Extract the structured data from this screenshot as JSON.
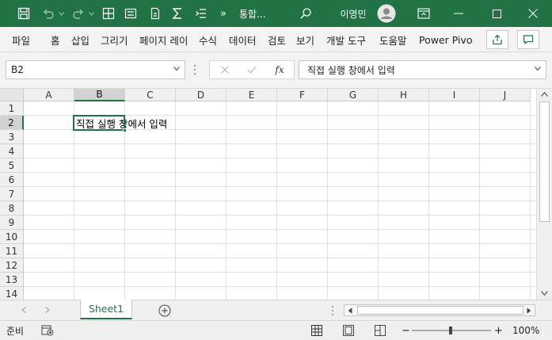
{
  "titlebar": {
    "doc_title": "통합...",
    "user_name": "이영민",
    "quick_access": [
      "save-icon",
      "undo-icon",
      "redo-icon",
      "table-icon",
      "form-icon",
      "document-icon",
      "sum-icon",
      "indent-icon"
    ],
    "more": "»"
  },
  "ribbon": {
    "tabs": [
      "파일",
      "홈",
      "삽입",
      "그리기",
      "페이지 레이",
      "수식",
      "데이터",
      "검토",
      "보기",
      "개발 도구",
      "도움말",
      "Power Pivo"
    ]
  },
  "formula_bar": {
    "name_box": "B2",
    "fx": "fx",
    "formula": "직접 실행 창에서 입력"
  },
  "grid": {
    "columns": [
      "A",
      "B",
      "C",
      "D",
      "E",
      "F",
      "G",
      "H",
      "I",
      "J"
    ],
    "rows": [
      "1",
      "2",
      "3",
      "4",
      "5",
      "6",
      "7",
      "8",
      "9",
      "10",
      "11",
      "12",
      "13",
      "14"
    ],
    "selected_cell": "B2",
    "cell_b2": "직접 실행 창에서 입력"
  },
  "sheets": {
    "active": "Sheet1",
    "add_label": "+"
  },
  "status": {
    "ready": "준비",
    "zoom_minus": "−",
    "zoom_plus": "+",
    "zoom": "100%"
  },
  "colors": {
    "accent": "#217346"
  }
}
